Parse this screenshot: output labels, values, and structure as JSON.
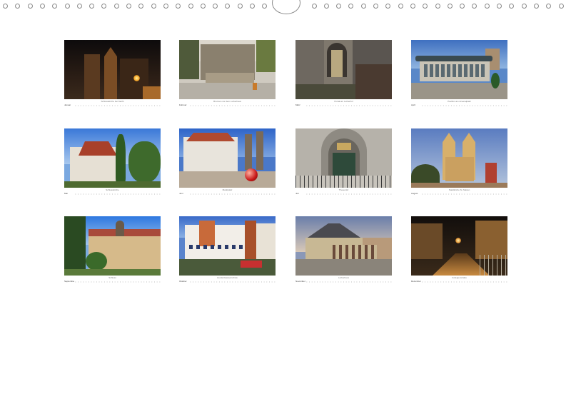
{
  "document": {
    "type": "wall calendar overview",
    "months": [
      {
        "label": "Januar",
        "caption": "Schlosskirche bei Nacht"
      },
      {
        "label": "Februar",
        "caption": "Brunnen vor dem Lutherhaus"
      },
      {
        "label": "März",
        "caption": "Portal am Lutherhof"
      },
      {
        "label": "April",
        "caption": "Pavillon am Arsenalplatz"
      },
      {
        "label": "Mai",
        "caption": "Schlosskirche"
      },
      {
        "label": "Juni",
        "caption": "Marktplatz"
      },
      {
        "label": "Juli",
        "caption": "Thesentür"
      },
      {
        "label": "August",
        "caption": "Stadtkirche St. Marien"
      },
      {
        "label": "September",
        "caption": "Schloss"
      },
      {
        "label": "Oktober",
        "caption": "Hundertwasserschule"
      },
      {
        "label": "November",
        "caption": "Lutherhaus"
      },
      {
        "label": "Dezember",
        "caption": "Collegienstraße"
      }
    ]
  }
}
